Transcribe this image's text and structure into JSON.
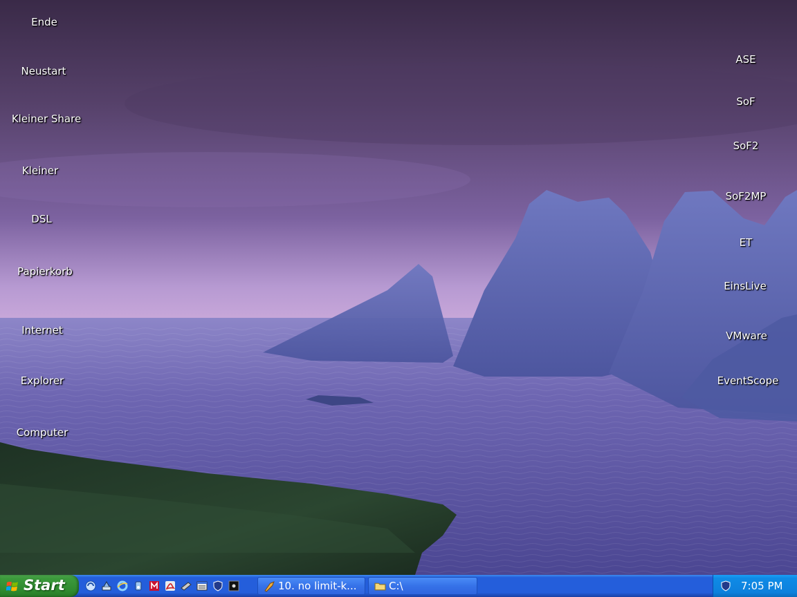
{
  "desktop": {
    "left_icons": [
      {
        "label": "Ende"
      },
      {
        "label": "Neustart"
      },
      {
        "label": "Kleiner Share"
      },
      {
        "label": "Kleiner"
      },
      {
        "label": "DSL"
      },
      {
        "label": "Papierkorb"
      },
      {
        "label": "Internet"
      },
      {
        "label": "Explorer"
      },
      {
        "label": "Computer"
      }
    ],
    "right_icons": [
      {
        "label": "ASE"
      },
      {
        "label": "SoF"
      },
      {
        "label": "SoF2"
      },
      {
        "label": "SoF2MP"
      },
      {
        "label": "ET"
      },
      {
        "label": "EinsLive"
      },
      {
        "label": "VMware"
      },
      {
        "label": "EventScope"
      }
    ]
  },
  "taskbar": {
    "start_label": "Start",
    "quick_launch": [
      {
        "icon": "browser-icon"
      },
      {
        "icon": "network-icon"
      },
      {
        "icon": "internet-explorer-icon"
      },
      {
        "icon": "media-icon"
      },
      {
        "icon": "mcafee-icon"
      },
      {
        "icon": "acrobat-icon"
      },
      {
        "icon": "memory-icon"
      },
      {
        "icon": "window-list-icon"
      },
      {
        "icon": "shield-icon"
      },
      {
        "icon": "console-icon"
      }
    ],
    "tasks": [
      {
        "label": "10.  no limit-k...",
        "icon": "media-player-icon"
      },
      {
        "label": "C:\\",
        "icon": "folder-icon"
      }
    ],
    "tray": {
      "clock": "7:05 PM",
      "icon": "shield-icon"
    }
  },
  "colors": {
    "taskbar_blue": "#245edb",
    "start_green": "#3c9a3c",
    "tray_blue": "#0f8be6"
  }
}
